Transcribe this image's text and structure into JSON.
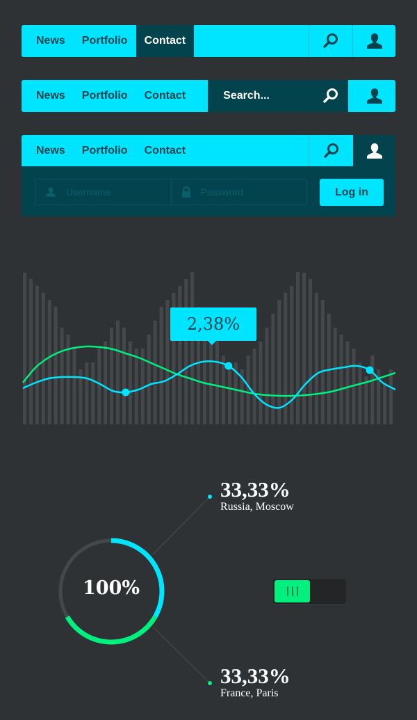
{
  "nav1": {
    "items": [
      {
        "label": "News",
        "active": false
      },
      {
        "label": "Portfolio",
        "active": false
      },
      {
        "label": "Contact",
        "active": true
      }
    ],
    "icons": [
      "search-icon",
      "user-icon"
    ]
  },
  "nav2": {
    "items": [
      {
        "label": "News"
      },
      {
        "label": "Portfolio"
      },
      {
        "label": "Contact"
      }
    ],
    "search_placeholder": "Search...",
    "icons": [
      "search-icon",
      "user-icon"
    ]
  },
  "nav3": {
    "items": [
      {
        "label": "News"
      },
      {
        "label": "Portfolio"
      },
      {
        "label": "Contact"
      }
    ],
    "username_placeholder": "Username",
    "password_placeholder": "Password",
    "login_label": "Log in",
    "icons": [
      "search-icon",
      "user-icon",
      "lock-icon"
    ]
  },
  "colors": {
    "accent": "#00e5ff",
    "dark_teal": "#02434e",
    "green": "#00f07f",
    "background": "#2f3235",
    "bar": "#45484b"
  },
  "chart_data": {
    "type": "bar",
    "title": "",
    "bars": [
      218,
      209,
      199,
      189,
      179,
      169,
      139,
      129,
      109,
      79,
      89,
      89,
      109,
      119,
      139,
      149,
      139,
      119,
      109,
      109,
      129,
      149,
      169,
      179,
      189,
      199,
      209,
      219,
      169,
      149,
      139,
      119,
      99,
      89,
      89,
      79,
      99,
      109,
      119,
      139,
      159,
      179,
      189,
      199,
      219,
      218,
      209,
      189,
      179,
      159,
      139,
      129,
      119,
      109,
      89,
      69,
      99,
      79,
      59,
      79
    ],
    "series": [
      {
        "name": "cyan-line",
        "color": "#00e5ff",
        "values": [
          52,
          60,
          66,
          68,
          68,
          66,
          58,
          48,
          46,
          50,
          58,
          62,
          72,
          84,
          90,
          90,
          84,
          68,
          44,
          28,
          24,
          36,
          58,
          74,
          79,
          82,
          84,
          78,
          60,
          50
        ]
      },
      {
        "name": "green-line",
        "color": "#00f07f",
        "values": [
          60,
          82,
          96,
          105,
          110,
          112,
          111,
          108,
          102,
          96,
          88,
          80,
          72,
          66,
          60,
          56,
          52,
          48,
          44,
          42,
          41,
          41,
          42,
          44,
          47,
          52,
          57,
          62,
          68,
          74
        ]
      }
    ],
    "highlight": {
      "label": "2,38%"
    },
    "ylim": [
      0,
      220
    ]
  },
  "donut": {
    "center_label": "100%",
    "segments": [
      {
        "name": "Russia, Moscow",
        "percent": "33,33%",
        "value": 33.33,
        "color": "#00e5ff"
      },
      {
        "name": "France, Paris",
        "percent": "33,33%",
        "value": 33.33,
        "color": "#00f07f"
      },
      {
        "name": "remaining",
        "value": 33.34,
        "color": "#45484b"
      }
    ]
  },
  "stats": [
    {
      "percent": "33,33%",
      "location": "Russia, Moscow"
    },
    {
      "percent": "33,33%",
      "location": "France, Paris"
    }
  ],
  "toggle": {
    "on": true
  }
}
